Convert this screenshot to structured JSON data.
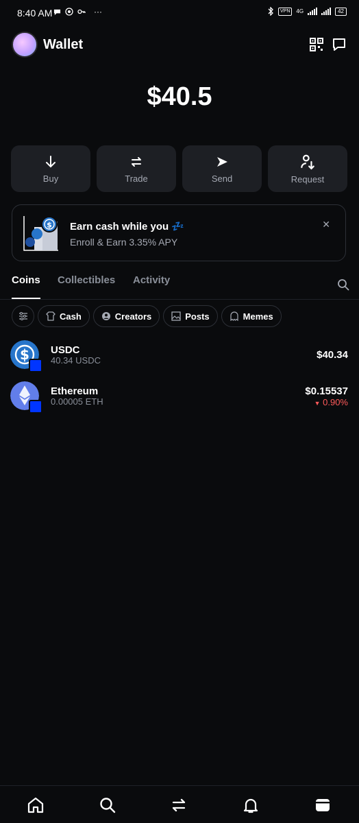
{
  "status_bar": {
    "time": "8:40 AM",
    "dots": "···",
    "vpn": "VPN",
    "network": "4G",
    "battery": "42"
  },
  "header": {
    "title": "Wallet"
  },
  "balance": "$40.5",
  "actions": [
    {
      "label": "Buy",
      "icon": "arrow-down-icon"
    },
    {
      "label": "Trade",
      "icon": "swap-icon"
    },
    {
      "label": "Send",
      "icon": "send-icon"
    },
    {
      "label": "Request",
      "icon": "request-icon"
    }
  ],
  "earn_banner": {
    "title": "Earn cash while you 💤",
    "subtitle": "Enroll & Earn 3.35% APY",
    "close": "✕"
  },
  "tabs": [
    "Coins",
    "Collectibles",
    "Activity"
  ],
  "active_tab": "Coins",
  "filters": [
    "Cash",
    "Creators",
    "Posts",
    "Memes"
  ],
  "coins": [
    {
      "name": "USDC",
      "amount": "40.34 USDC",
      "value": "$40.34",
      "change": ""
    },
    {
      "name": "Ethereum",
      "amount": "0.00005 ETH",
      "value": "$0.15537",
      "change": "0.90%"
    }
  ],
  "colors": {
    "background": "#0a0b0d",
    "card": "#1d1f24",
    "muted_text": "#a5a9b3",
    "negative": "#ff5a5a",
    "usdc": "#2775ca",
    "eth": "#627eea",
    "network_badge": "#0035ff"
  },
  "bottom_nav": [
    "home-icon",
    "search-icon",
    "swap-icon",
    "bell-icon",
    "wallet-icon"
  ]
}
